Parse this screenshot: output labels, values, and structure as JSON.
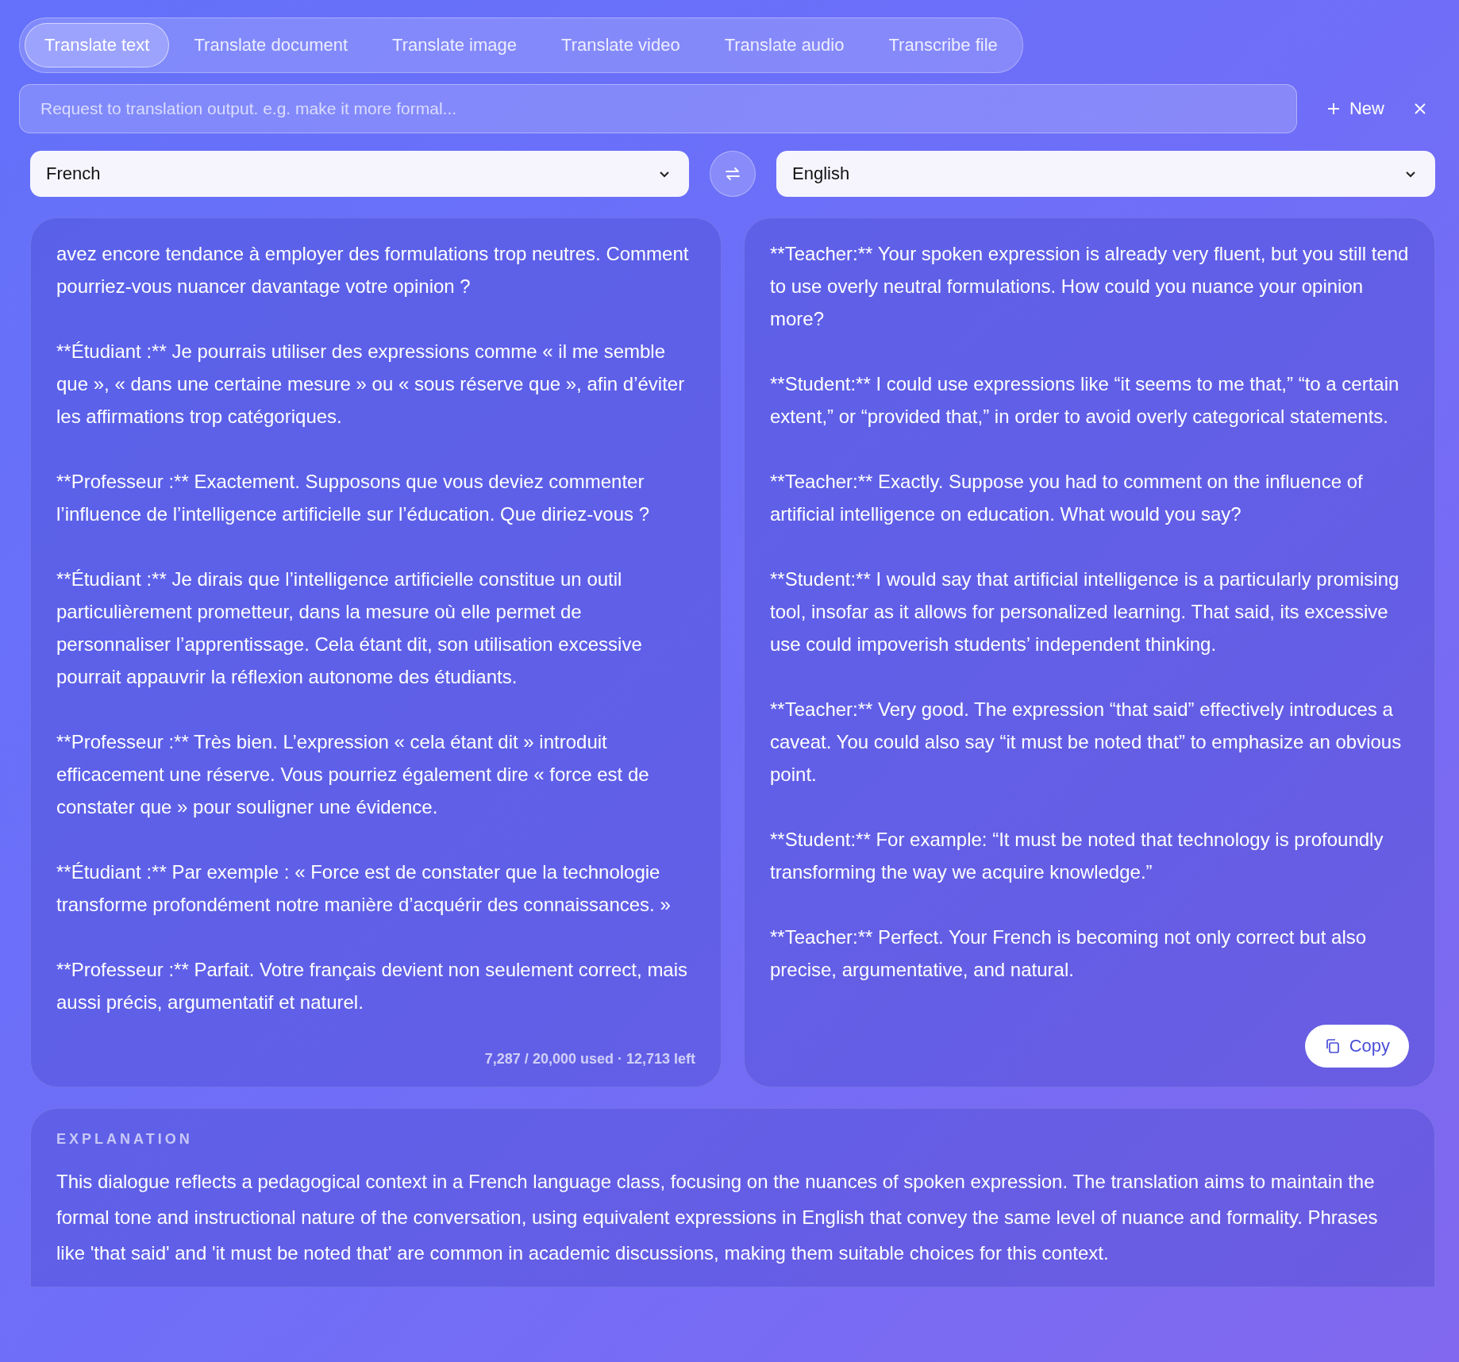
{
  "tabs": [
    {
      "label": "Translate text",
      "selected": true
    },
    {
      "label": "Translate document",
      "selected": false
    },
    {
      "label": "Translate image",
      "selected": false
    },
    {
      "label": "Translate video",
      "selected": false
    },
    {
      "label": "Translate audio",
      "selected": false
    },
    {
      "label": "Transcribe file",
      "selected": false
    }
  ],
  "request_field": {
    "placeholder": "Request to translation output. e.g. make it more formal..."
  },
  "new_button": "New",
  "source_language": "French",
  "target_language": "English",
  "source_text": [
    "avez encore tendance à employer des formulations trop neutres. Comment pourriez-vous nuancer davantage votre opinion ?",
    "**Étudiant :** Je pourrais utiliser des expressions comme « il me semble que », « dans une certaine mesure » ou « sous réserve que », afin d’éviter les affirmations trop catégoriques.",
    "**Professeur :** Exactement. Supposons que vous deviez commenter l’influence de l’intelligence artificielle sur l’éducation. Que diriez-vous ?",
    "**Étudiant :** Je dirais que l’intelligence artificielle constitue un outil particulièrement prometteur, dans la mesure où elle permet de personnaliser l’apprentissage. Cela étant dit, son utilisation excessive pourrait appauvrir la réflexion autonome des étudiants.",
    "**Professeur :** Très bien. L’expression « cela étant dit » introduit efficacement une réserve. Vous pourriez également dire « force est de constater que » pour souligner une évidence.",
    "**Étudiant :** Par exemple : « Force est de constater que la technologie transforme profondément notre manière d’acquérir des connaissances. »",
    "**Professeur :** Parfait. Votre français devient non seulement correct, mais aussi précis, argumentatif et naturel."
  ],
  "char_count": "7,287 / 20,000 used · 12,713 left",
  "target_text": [
    "**Teacher:** Your spoken expression is already very fluent, but you still tend to use overly neutral formulations. How could you nuance your opinion more?",
    "**Student:** I could use expressions like “it seems to me that,” “to a certain extent,” or “provided that,” in order to avoid overly categorical statements.",
    "**Teacher:** Exactly. Suppose you had to comment on the influence of artificial intelligence on education. What would you say?",
    "**Student:** I would say that artificial intelligence is a particularly promising tool, insofar as it allows for personalized learning. That said, its excessive use could impoverish students’ independent thinking.",
    "**Teacher:** Very good. The expression “that said” effectively introduces a caveat. You could also say “it must be noted that” to emphasize an obvious point.",
    "**Student:** For example: “It must be noted that technology is profoundly transforming the way we acquire knowledge.”",
    "**Teacher:** Perfect. Your French is becoming not only correct but also precise, argumentative, and natural."
  ],
  "copy_button": "Copy",
  "explanation": {
    "label": "EXPLANATION",
    "text": "This dialogue reflects a pedagogical context in a French language class, focusing on the nuances of spoken expression. The translation aims to maintain the formal tone and instructional nature of the conversation, using equivalent expressions in English that convey the same level of nuance and formality. Phrases like 'that said' and 'it must be noted that' are common in academic discussions, making them suitable choices for this context."
  }
}
